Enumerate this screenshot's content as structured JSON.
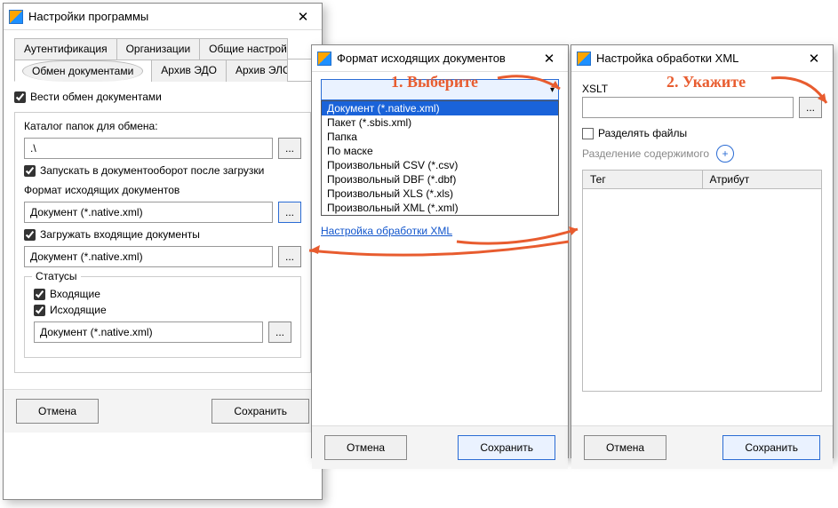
{
  "win1": {
    "title": "Настройки программы",
    "tabs": [
      "Аутентификация",
      "Организации",
      "Общие настройки",
      "Обмен документами",
      "Архив ЭДО",
      "Архив ЭЛО"
    ],
    "exchange_chk": "Вести обмен документами",
    "folder_label": "Каталог папок для обмена:",
    "folder_value": ".\\",
    "launch_chk": "Запускать в документооборот после загрузки",
    "out_format_label": "Формат исходящих документов",
    "out_format_value": "Документ (*.native.xml)",
    "load_incoming_chk": "Загружать входящие документы",
    "incoming_value": "Документ (*.native.xml)",
    "statuses_label": "Статусы",
    "status_in": "Входящие",
    "status_out": "Исходящие",
    "status_value": "Документ (*.native.xml)",
    "cancel": "Отмена",
    "save": "Сохранить"
  },
  "win2": {
    "title": "Формат исходящих документов",
    "options": [
      "Документ (*.native.xml)",
      "Пакет (*.sbis.xml)",
      "Папка",
      "По маске",
      "Произвольный CSV (*.csv)",
      "Произвольный DBF (*.dbf)",
      "Произвольный XLS (*.xls)",
      "Произвольный XML (*.xml)"
    ],
    "link": "Настройка обработки XML",
    "cancel": "Отмена",
    "save": "Сохранить"
  },
  "win3": {
    "title": "Настройка обработки XML",
    "xslt": "XSLT",
    "split": "Разделять файлы",
    "split_content": "Разделение содержимого",
    "col_tag": "Тег",
    "col_attr": "Атрибут",
    "cancel": "Отмена",
    "save": "Сохранить"
  },
  "annot": {
    "a1": "1. Выберите",
    "a2": "2. Укажите"
  }
}
